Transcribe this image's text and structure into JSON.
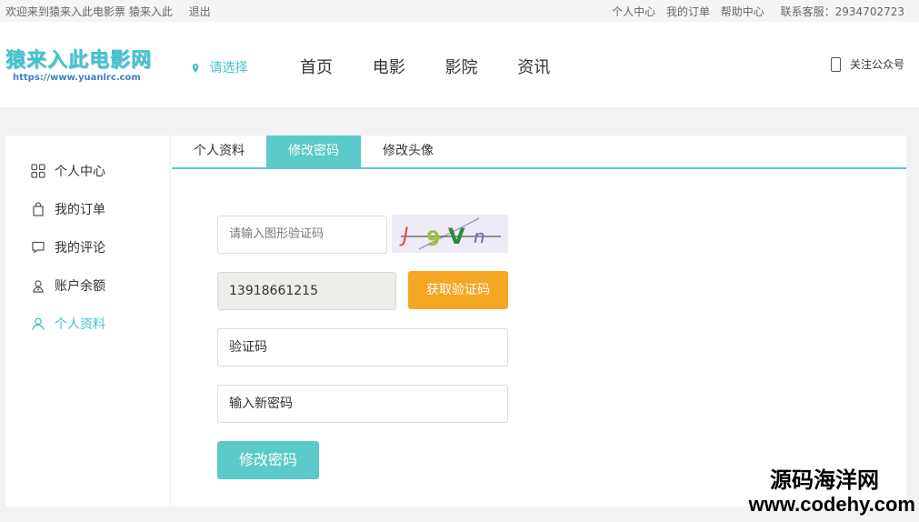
{
  "topbar": {
    "welcome": "欢迎来到猿来入此电影票 猿来入此",
    "logout": "退出",
    "links": [
      "个人中心",
      "我的订单",
      "帮助中心"
    ],
    "service": "联系客服：2934702723"
  },
  "header": {
    "logo_title": "猿来入此电影网",
    "logo_url": "https://www.yuanlrc.com",
    "city": "请选择",
    "nav": [
      "首页",
      "电影",
      "影院",
      "资讯"
    ],
    "follow": "关注公众号"
  },
  "sidebar": {
    "items": [
      {
        "label": "个人中心",
        "icon": "grid-icon"
      },
      {
        "label": "我的订单",
        "icon": "bag-icon"
      },
      {
        "label": "我的评论",
        "icon": "comment-icon"
      },
      {
        "label": "账户余额",
        "icon": "wallet-icon"
      },
      {
        "label": "个人资料",
        "icon": "user-icon"
      }
    ],
    "active_index": 4
  },
  "tabs": [
    "个人资料",
    "修改密码",
    "修改头像"
  ],
  "form": {
    "captcha_placeholder": "请输入图形验证码",
    "phone_value": "13918661215",
    "get_code_label": "获取验证码",
    "sms_code_placeholder": "验证码",
    "new_password_placeholder": "输入新密码",
    "submit_label": "修改密码",
    "captcha_text": "J9Vn"
  },
  "watermark": {
    "line1": "源码海洋网",
    "line2": "www.codehy.com"
  },
  "colors": {
    "accent": "#5bcaca",
    "orange": "#f5a623"
  }
}
